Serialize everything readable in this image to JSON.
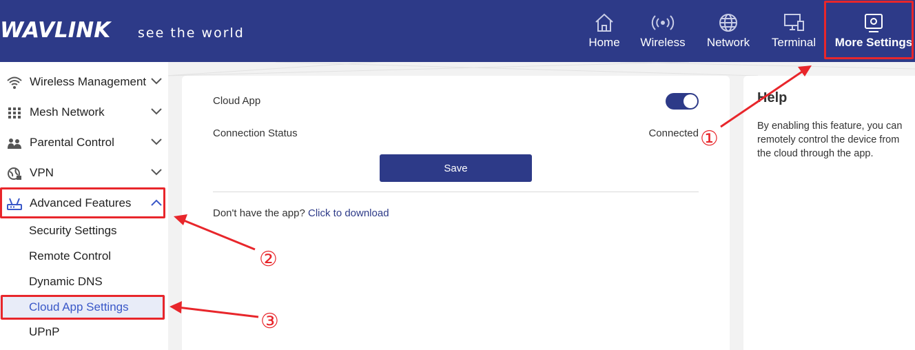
{
  "brand": {
    "logo": "WAVLINK",
    "slogan": "see the world"
  },
  "nav": [
    {
      "label": "Home",
      "icon": "home-icon"
    },
    {
      "label": "Wireless",
      "icon": "wireless-icon"
    },
    {
      "label": "Network",
      "icon": "globe-icon"
    },
    {
      "label": "Terminal",
      "icon": "monitor-icon"
    },
    {
      "label": "More Settings",
      "icon": "settings-icon"
    }
  ],
  "sidebar": {
    "groups": [
      {
        "label": "Wireless Management",
        "icon": "wifi-icon"
      },
      {
        "label": "Mesh Network",
        "icon": "grid-icon"
      },
      {
        "label": "Parental Control",
        "icon": "parents-icon"
      },
      {
        "label": "VPN",
        "icon": "vpn-globe-icon"
      },
      {
        "label": "Advanced Features",
        "icon": "router-icon"
      }
    ],
    "subitems": [
      {
        "label": "Security Settings"
      },
      {
        "label": "Remote Control"
      },
      {
        "label": "Dynamic DNS"
      },
      {
        "label": "Cloud App Settings",
        "active": true
      },
      {
        "label": "UPnP"
      }
    ]
  },
  "main": {
    "cloud_app_label": "Cloud App",
    "cloud_app_enabled": true,
    "connection_status_label": "Connection Status",
    "connection_status_value": "Connected",
    "save_label": "Save",
    "download_prompt": "Don't have the app?",
    "download_link": "Click to download"
  },
  "help": {
    "title": "Help",
    "text": "By enabling this feature, you can remotely control the device from the cloud through the app."
  },
  "annotations": {
    "marker1": "①",
    "marker2": "②",
    "marker3": "③",
    "color": "#e8262b"
  },
  "colors": {
    "brand": "#2d3a88",
    "accent": "#3a58c8",
    "active_bg": "#e8ecf8"
  }
}
